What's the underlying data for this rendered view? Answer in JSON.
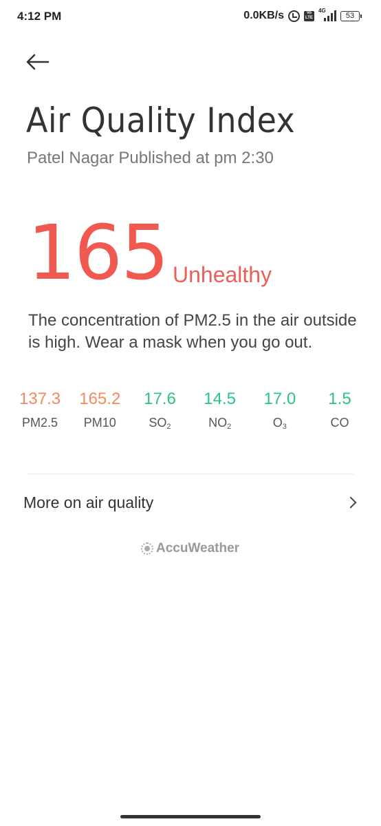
{
  "status_bar": {
    "time": "4:12 PM",
    "network_speed": "0.0KB/s",
    "volte_label": "Vo LTE",
    "network_type": "4G",
    "battery_level": "53",
    "icons": [
      "alarm-icon",
      "volte-icon",
      "signal-icon",
      "battery-icon"
    ]
  },
  "header": {
    "back_icon": "arrow-left-icon",
    "title": "Air Quality Index",
    "subtitle": "Patel Nagar Published at pm 2:30"
  },
  "aqi": {
    "value": "165",
    "status": "Unhealthy",
    "color": "#f0594f",
    "description": "The concentration of PM2.5 in the air outside is high. Wear a mask when you go out."
  },
  "pollutants": [
    {
      "value": "137.3",
      "name": "PM2.5",
      "sub": "",
      "color": "#f28a5a"
    },
    {
      "value": "165.2",
      "name": "PM10",
      "sub": "",
      "color": "#f28a5a"
    },
    {
      "value": "17.6",
      "name": "SO",
      "sub": "2",
      "color": "#2cc57f"
    },
    {
      "value": "14.5",
      "name": "NO",
      "sub": "2",
      "color": "#2cc57f"
    },
    {
      "value": "17.0",
      "name": "O",
      "sub": "3",
      "color": "#2cc57f"
    },
    {
      "value": "1.5",
      "name": "CO",
      "sub": "",
      "color": "#2cc57f"
    }
  ],
  "more": {
    "label": "More on air quality",
    "icon": "chevron-right-icon"
  },
  "provider": {
    "name": "AccuWeather",
    "icon": "sun-logo-icon"
  }
}
